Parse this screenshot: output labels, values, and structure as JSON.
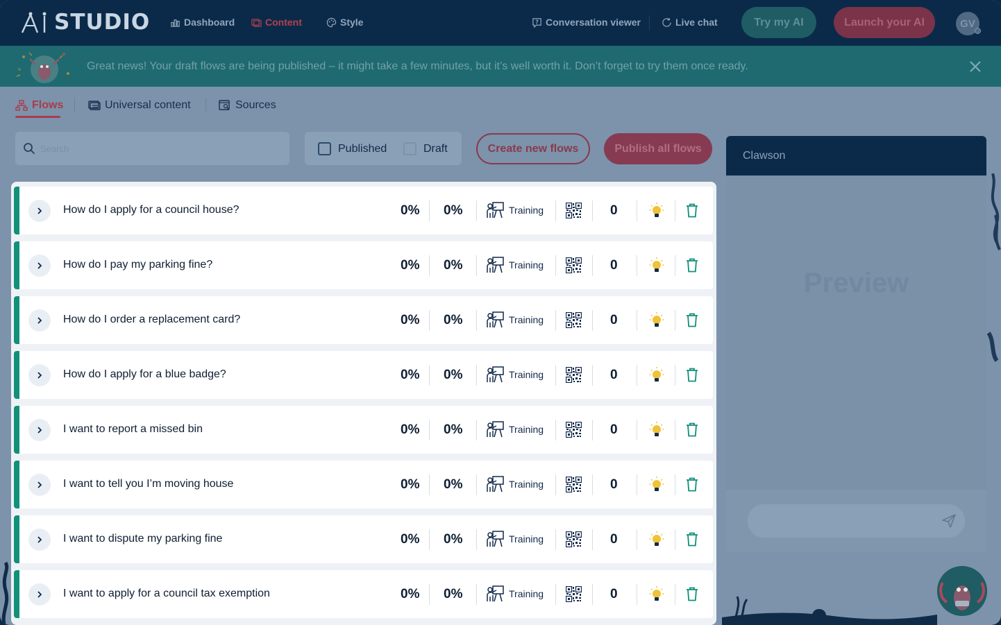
{
  "app": {
    "logo_text": "STUDIO"
  },
  "nav": {
    "items": [
      {
        "label": "Dashboard",
        "icon": "bar-chart-icon"
      },
      {
        "label": "Content",
        "icon": "content-icon",
        "active": true
      },
      {
        "label": "Style",
        "icon": "palette-icon"
      },
      {
        "label": "Conversation viewer",
        "icon": "conversation-icon"
      },
      {
        "label": "Live chat",
        "icon": "live-chat-icon"
      }
    ],
    "try_label": "Try my AI",
    "launch_label": "Launch your AI",
    "avatar_initials": "GV"
  },
  "banner": {
    "text": "Great news! Your draft flows are being published – it might take a few minutes, but it’s well worth it. Don’t forget to try them once ready."
  },
  "subtabs": [
    {
      "label": "Flows",
      "active": true,
      "icon": "flows-icon"
    },
    {
      "label": "Universal content",
      "icon": "universal-content-icon"
    },
    {
      "label": "Sources",
      "icon": "sources-icon"
    }
  ],
  "controls": {
    "search_placeholder": "Search",
    "published_label": "Published",
    "draft_label": "Draft",
    "create_label": "Create new flows",
    "publish_label": "Publish all flows"
  },
  "flows": [
    {
      "title": "How do I apply for a council house?",
      "stat1": "0%",
      "stat2": "0%",
      "training": "Training",
      "count": "0"
    },
    {
      "title": "How do I pay my parking fine?",
      "stat1": "0%",
      "stat2": "0%",
      "training": "Training",
      "count": "0"
    },
    {
      "title": "How do I order a replacement card?",
      "stat1": "0%",
      "stat2": "0%",
      "training": "Training",
      "count": "0"
    },
    {
      "title": "How do I apply for a blue badge?",
      "stat1": "0%",
      "stat2": "0%",
      "training": "Training",
      "count": "0"
    },
    {
      "title": "I want to report a missed bin",
      "stat1": "0%",
      "stat2": "0%",
      "training": "Training",
      "count": "0"
    },
    {
      "title": "I want to tell you I’m moving house",
      "stat1": "0%",
      "stat2": "0%",
      "training": "Training",
      "count": "0"
    },
    {
      "title": "I want to dispute my parking fine",
      "stat1": "0%",
      "stat2": "0%",
      "training": "Training",
      "count": "0"
    },
    {
      "title": "I want to apply for a council tax exemption",
      "stat1": "0%",
      "stat2": "0%",
      "training": "Training",
      "count": "0"
    }
  ],
  "preview": {
    "title": "Clawson",
    "watermark": "Preview"
  },
  "colors": {
    "accent_teal": "#11907a",
    "brand_red": "#a83c4d",
    "navy": "#0b2a4a"
  }
}
